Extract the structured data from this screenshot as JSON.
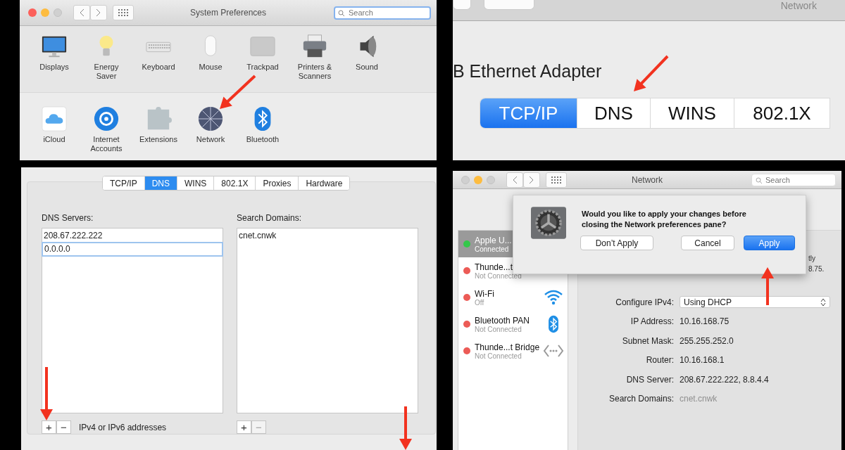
{
  "system_preferences": {
    "title": "System Preferences",
    "search": {
      "placeholder": "Search"
    },
    "sections": [
      {
        "items": [
          {
            "label": "Displays"
          },
          {
            "label": "Energy Saver"
          },
          {
            "label": "Keyboard"
          },
          {
            "label": "Mouse"
          },
          {
            "label": "Trackpad"
          },
          {
            "label": "Printers & Scanners"
          },
          {
            "label": "Sound"
          }
        ]
      },
      {
        "items": [
          {
            "label": "iCloud"
          },
          {
            "label": "Internet Accounts"
          },
          {
            "label": "Extensions"
          },
          {
            "label": "Network"
          },
          {
            "label": "Bluetooth"
          }
        ]
      }
    ]
  },
  "tabs_closeup": {
    "title": "Network",
    "heading": "B Ethernet Adapter",
    "tabs": [
      {
        "label": "TCP/IP",
        "selected": true
      },
      {
        "label": "DNS",
        "selected": false
      },
      {
        "label": "WINS",
        "selected": false
      },
      {
        "label": "802.1X",
        "selected": false
      }
    ]
  },
  "dns_pane": {
    "tabs": [
      {
        "label": "TCP/IP",
        "selected": false
      },
      {
        "label": "DNS",
        "selected": true
      },
      {
        "label": "WINS",
        "selected": false
      },
      {
        "label": "802.1X",
        "selected": false
      },
      {
        "label": "Proxies",
        "selected": false
      },
      {
        "label": "Hardware",
        "selected": false
      }
    ],
    "dns_servers": {
      "label": "DNS Servers:",
      "entries": [
        {
          "value": "208.67.222.222",
          "selected": false
        },
        {
          "value": "0.0.0.0",
          "selected": true
        }
      ],
      "add": {
        "label": "+",
        "disabled": false
      },
      "remove": {
        "label": "−",
        "disabled": false
      },
      "hint": "IPv4 or IPv6 addresses"
    },
    "search_domains": {
      "label": "Search Domains:",
      "entries": [
        {
          "value": "cnet.cnwk",
          "selected": false
        }
      ],
      "add": {
        "label": "+",
        "disabled": false
      },
      "remove": {
        "label": "−",
        "disabled": true
      }
    }
  },
  "network_window": {
    "title": "Network",
    "search": {
      "placeholder": "Search"
    },
    "services": [
      {
        "name": "Apple U...",
        "status": "Connected",
        "color": "#34c84a",
        "selected": true
      },
      {
        "name": "Thunde...t",
        "status": "Not Connected",
        "color": "#ec5b56",
        "selected": false
      },
      {
        "name": "Wi-Fi",
        "status": "Off",
        "color": "#ec5b56",
        "selected": false
      },
      {
        "name": "Bluetooth PAN",
        "status": "Not Connected",
        "color": "#ec5b56",
        "selected": false
      },
      {
        "name": "Thunde...t Bridge",
        "status": "Not Connected",
        "color": "#ec5b56",
        "selected": false
      }
    ],
    "fragments": [
      "tly",
      "8.75."
    ],
    "fields": [
      {
        "kind": "select",
        "label": "Configure IPv4:",
        "value": "Using DHCP"
      },
      {
        "kind": "text",
        "label": "IP Address:",
        "value": "10.16.168.75"
      },
      {
        "kind": "text",
        "label": "Subnet Mask:",
        "value": "255.255.252.0"
      },
      {
        "kind": "text",
        "label": "Router:",
        "value": "10.16.168.1"
      },
      {
        "kind": "text",
        "label": "DNS Server:",
        "value": "208.67.222.222, 8.8.4.4"
      },
      {
        "kind": "placeholder",
        "label": "Search Domains:",
        "placeholder": "cnet.cnwk"
      }
    ],
    "dialog": {
      "message": "Would you like to apply your changes before closing the Network preferences pane?",
      "buttons": [
        {
          "label": "Don’t Apply",
          "default": false
        },
        {
          "label": "Cancel",
          "default": false
        },
        {
          "label": "Apply",
          "default": true
        }
      ]
    }
  }
}
